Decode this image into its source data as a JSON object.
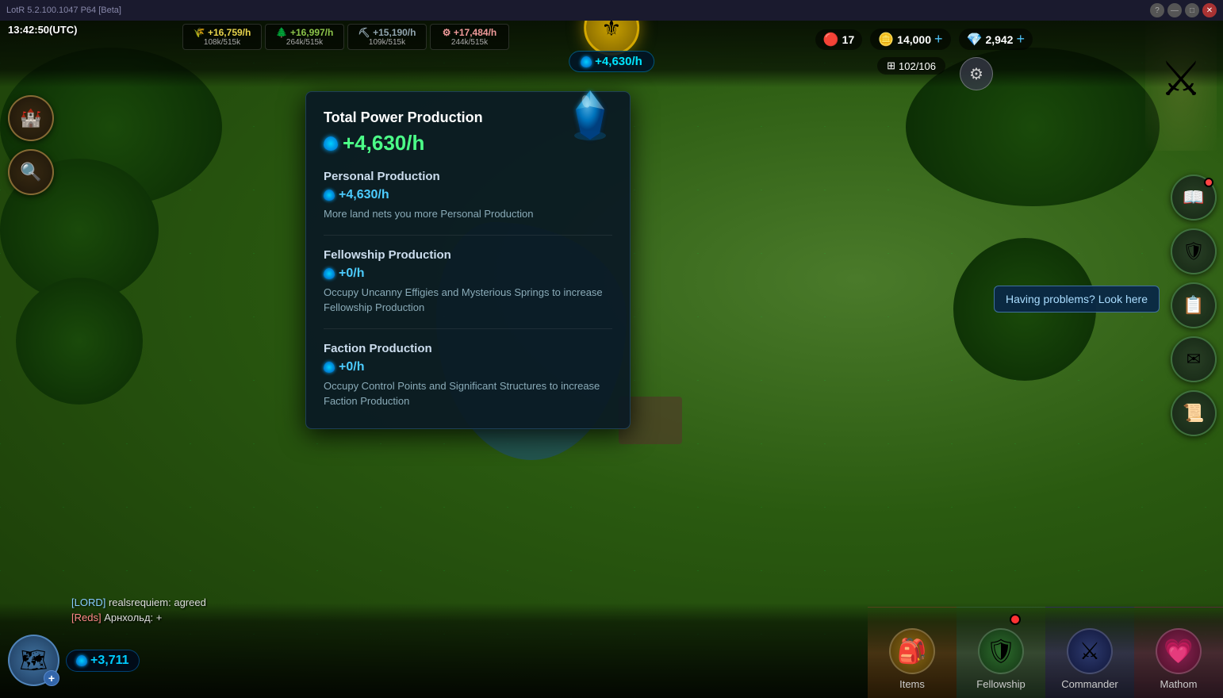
{
  "titlebar": {
    "app_name": "LotR 5.2.100.1047 P64 [Beta]",
    "help_label": "?",
    "min_label": "—",
    "max_label": "□",
    "close_label": "✕"
  },
  "topbar": {
    "time": "13:42:50(UTC)",
    "resources": [
      {
        "rate": "+16,759/h",
        "storage": "108k/515k",
        "type": "food"
      },
      {
        "rate": "+16,997/h",
        "storage": "264k/515k",
        "type": "wood"
      },
      {
        "rate": "+15,190/h",
        "storage": "109k/515k",
        "type": "stone"
      },
      {
        "rate": "+17,484/h",
        "storage": "244k/515k",
        "type": "ore"
      }
    ],
    "power_rate": "+4,630/h",
    "currency1_label": "17",
    "currency2_label": "14,000",
    "currency3_label": "2,942",
    "grid_count": "102/106"
  },
  "popup": {
    "title": "Total Power Production",
    "main_rate": "+4,630/h",
    "sections": [
      {
        "title": "Personal Production",
        "rate": "+4,630/h",
        "description": "More land nets you more Personal Production"
      },
      {
        "title": "Fellowship Production",
        "rate": "+0/h",
        "description": "Occupy Uncanny Effigies and Mysterious Springs to increase Fellowship Production"
      },
      {
        "title": "Faction Production",
        "rate": "+0/h",
        "description": "Occupy Control Points and Significant Structures to increase Faction Production"
      }
    ]
  },
  "help_tooltip": "Having problems? Look here",
  "player": {
    "power": "+3,711"
  },
  "chat": [
    {
      "prefix": "[LORD]",
      "username": "realsrequiem",
      "message": "agreed",
      "type": "lord"
    },
    {
      "prefix": "[Reds]",
      "username": "Арнхольд",
      "message": "+",
      "type": "reds"
    }
  ],
  "bottom_nav": [
    {
      "label": "Items",
      "icon": "🎒",
      "style": "items",
      "has_notification": false
    },
    {
      "label": "Fellowship",
      "icon": "🛡",
      "style": "fellowship",
      "has_notification": true
    },
    {
      "label": "Commander",
      "icon": "⚔",
      "style": "commander",
      "has_notification": false
    },
    {
      "label": "Mathom",
      "icon": "💗",
      "style": "mathom",
      "has_notification": false
    }
  ],
  "left_buttons": [
    {
      "icon": "🏰",
      "name": "castle-button"
    },
    {
      "icon": "🔍",
      "name": "search-button"
    }
  ],
  "right_buttons": [
    {
      "icon": "📖",
      "name": "quest-book-button",
      "has_notification": true
    },
    {
      "icon": "🛡",
      "name": "troop-button",
      "has_notification": false
    },
    {
      "icon": "📋",
      "name": "report-button",
      "has_notification": false
    },
    {
      "icon": "✉",
      "name": "mail-button",
      "has_notification": false
    },
    {
      "icon": "📜",
      "name": "scroll-button",
      "has_notification": false
    }
  ],
  "colors": {
    "accent_teal": "#00e5ff",
    "accent_green": "#4cff88",
    "panel_bg": "rgba(10,25,35,0.93)",
    "title_bar_bg": "#1a1a2e"
  }
}
